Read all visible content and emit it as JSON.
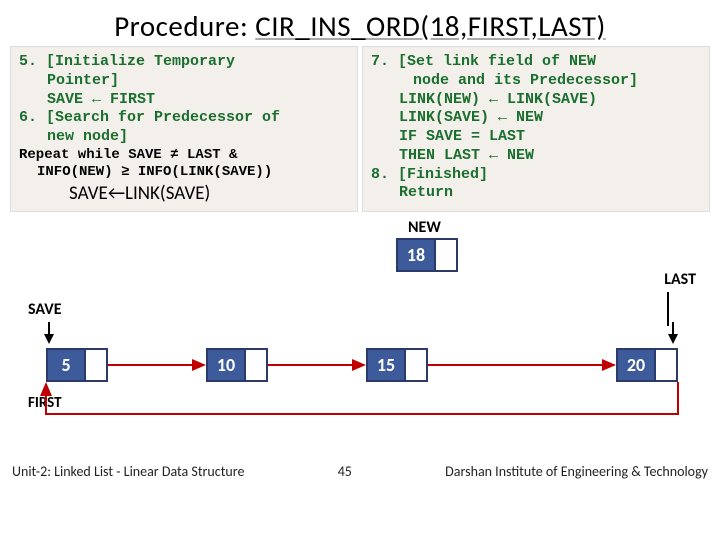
{
  "title_pre": "Procedure: ",
  "title_u": "CIR_INS_ORD(18,FIRST,LAST)",
  "left": {
    "l1": "5. [Initialize Temporary",
    "l2": "Pointer]",
    "l3": "SAVE ← FIRST",
    "l4": "6. [Search for Predecessor of",
    "l5": "new node]",
    "r1": "Repeat while SAVE ≠ LAST &",
    "r2": "INFO(NEW) ≥ INFO(LINK(SAVE))",
    "sv": "SAVE←LINK(SAVE)"
  },
  "right": {
    "l1": "7. [Set link field of NEW",
    "l2": "node and its Predecessor]",
    "l3": "LINK(NEW) ← LINK(SAVE)",
    "l4": "LINK(SAVE) ← NEW",
    "l5": "IF   SAVE = LAST",
    "l6": "THEN LAST ← NEW",
    "l7": "8. [Finished]",
    "l8": "Return"
  },
  "labels": {
    "new": "NEW",
    "last": "LAST",
    "save": "SAVE",
    "first": "FIRST"
  },
  "nodes": {
    "new": "18",
    "n1": "5",
    "n2": "10",
    "n3": "15",
    "n4": "20"
  },
  "footer": {
    "left": "Unit-2: Linked List - Linear Data Structure",
    "mid": "45",
    "right": "Darshan Institute of Engineering & Technology"
  }
}
